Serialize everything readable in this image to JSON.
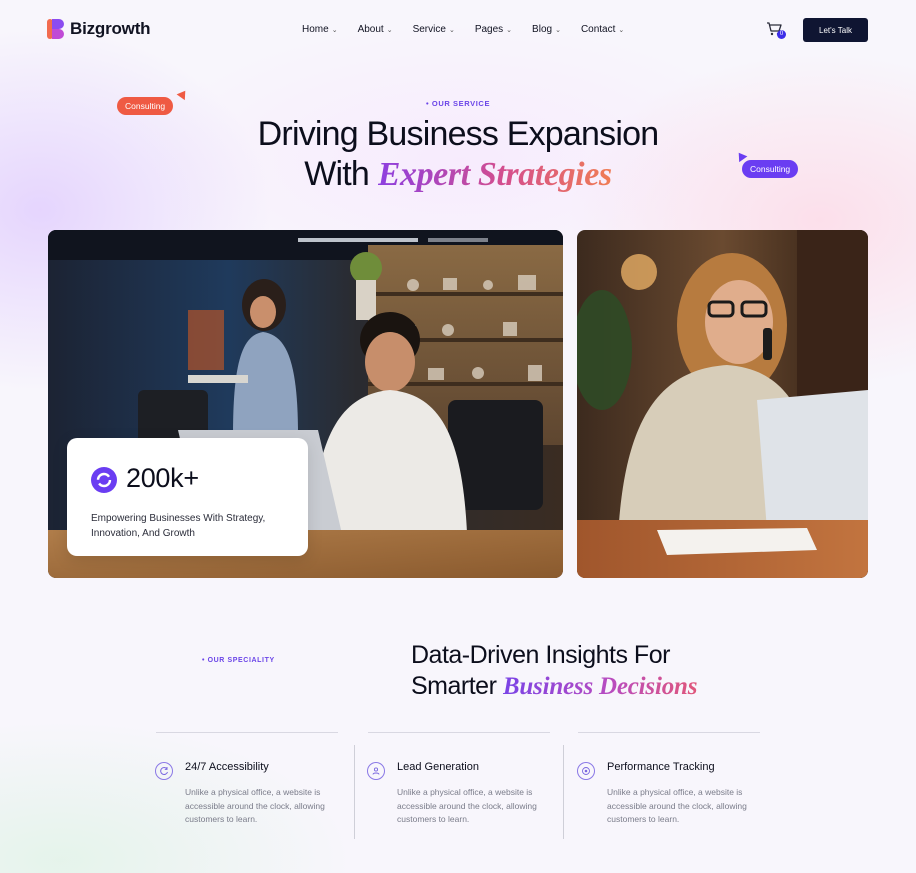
{
  "brand": {
    "name": "Bizgrowth"
  },
  "nav": {
    "items": [
      {
        "label": "Home"
      },
      {
        "label": "About"
      },
      {
        "label": "Service"
      },
      {
        "label": "Pages"
      },
      {
        "label": "Blog"
      },
      {
        "label": "Contact"
      }
    ],
    "cart_count": "0",
    "cta_label": "Let's Talk"
  },
  "hero": {
    "eyebrow": "• OUR SERVICE",
    "title_line1": "Driving Business Expansion",
    "title_line2_plain": "With",
    "title_line2_accent": "Expert Strategies",
    "tag_left": "Consulting",
    "tag_right": "Consulting"
  },
  "stat": {
    "value": "200k+",
    "description": "Empowering Businesses With Strategy, Innovation, And Growth"
  },
  "speciality": {
    "eyebrow": "• OUR SPECIALITY",
    "title_line1": "Data-Driven Insights For",
    "title_line2_plain": "Smarter",
    "title_line2_accent": "Business Decisions",
    "features": [
      {
        "icon": "refresh-icon",
        "title": "24/7 Accessibility",
        "description": "Unlike a physical office, a website is accessible around the clock, allowing customers to learn."
      },
      {
        "icon": "team-icon",
        "title": "Lead Generation",
        "description": "Unlike a physical office, a website is accessible around the clock, allowing customers to learn."
      },
      {
        "icon": "target-icon",
        "title": "Performance Tracking",
        "description": "Unlike a physical office, a website is accessible around the clock, allowing customers to learn."
      }
    ]
  },
  "colors": {
    "primary": "#6a3df2",
    "accent_orange": "#ef5a43",
    "navy": "#0f1532"
  }
}
